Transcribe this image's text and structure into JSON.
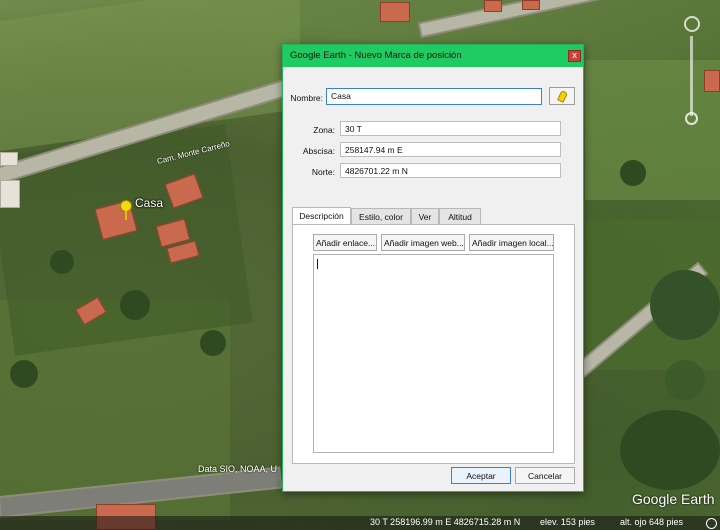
{
  "window": {
    "title": "Google Earth - Nuevo Marca de posición",
    "close_label": "x"
  },
  "form": {
    "name_label": "Nombre:",
    "name_value": "Casa",
    "zone_label": "Zona:",
    "zone_value": "30 T",
    "easting_label": "Abscisa:",
    "easting_value": "258147.94 m E",
    "northing_label": "Norte:",
    "northing_value": "4826701.22 m N"
  },
  "tabs": [
    {
      "label": "Descripción",
      "active": true
    },
    {
      "label": "Estilo, color",
      "active": false
    },
    {
      "label": "Ver",
      "active": false
    },
    {
      "label": "Altitud",
      "active": false
    }
  ],
  "description_buttons": {
    "add_link": "Añadir enlace...",
    "add_web_image": "Añadir imagen web...",
    "add_local_image": "Añadir imagen local..."
  },
  "description_text": "",
  "footer": {
    "ok_label": "Aceptar",
    "cancel_label": "Cancelar"
  },
  "map": {
    "placemark_label": "Casa",
    "road_label": "Cam. Monte Carreño",
    "credit": "Data SIO, NOAA, U",
    "logo": "Google Earth",
    "status": {
      "coordinates": "30 T 258196.99 m E 4826715.28 m N",
      "elevation": "elev.  153 pies",
      "eye_altitude": "alt. ojo   648 pies"
    }
  },
  "colors": {
    "titlebar": "#1fcc63",
    "placemark": "#f5d90a"
  },
  "icons": {
    "placemark": "yellow-pushpin-icon",
    "close": "close-icon",
    "globe": "globe-icon"
  }
}
